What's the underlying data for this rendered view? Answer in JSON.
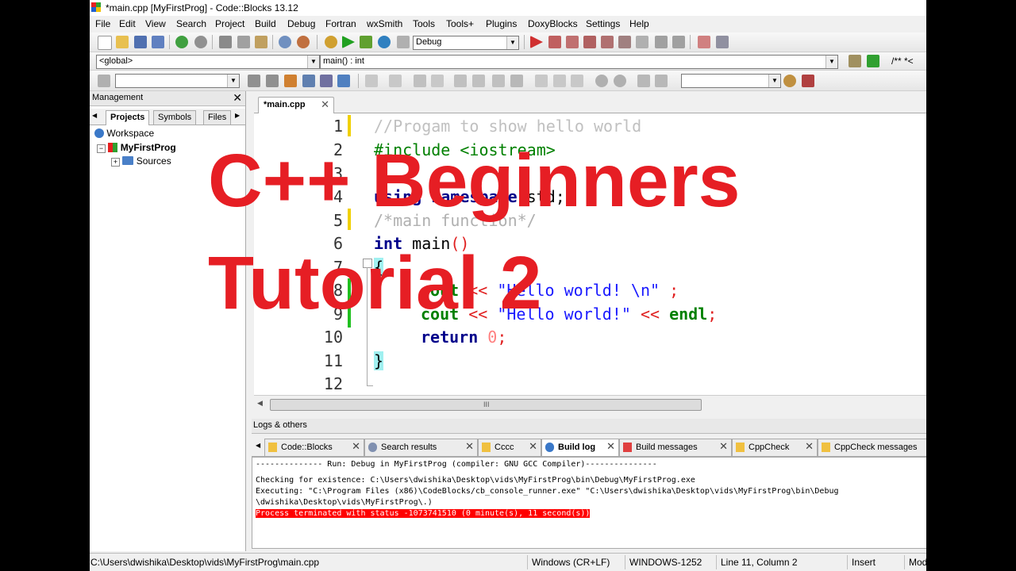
{
  "window": {
    "title": "*main.cpp [MyFirstProg] - Code::Blocks 13.12"
  },
  "menu": [
    "File",
    "Edit",
    "View",
    "Search",
    "Project",
    "Build",
    "Debug",
    "Fortran",
    "wxSmith",
    "Tools",
    "Tools+",
    "Plugins",
    "DoxyBlocks",
    "Settings",
    "Help"
  ],
  "toolbar": {
    "build_target": "Debug",
    "scope": "<global>",
    "function": "main() : int",
    "doxy_text": "/** *<"
  },
  "management": {
    "title": "Management",
    "tabs": [
      "Projects",
      "Symbols",
      "Files"
    ],
    "tree": {
      "workspace": "Workspace",
      "project": "MyFirstProg",
      "folder": "Sources"
    }
  },
  "editor": {
    "tab_label": "*main.cpp",
    "line_numbers": [
      "1",
      "2",
      "3",
      "4",
      "5",
      "6",
      "7",
      "8",
      "9",
      "10",
      "11",
      "12"
    ],
    "lines": {
      "l1": "//Progam to show hello world",
      "l2a": "#include ",
      "l2b": "<iostream>",
      "l4a": "using namespace ",
      "l4b": "std;",
      "l5": "/*main function*/",
      "l6a": "int ",
      "l6b": "main",
      "l6c": "()",
      "l7": "{",
      "l8a": "cout",
      "l8b": " << ",
      "l8c": "\"Hello world! \\n\"",
      "l8d": " ;",
      "l9a": "cout",
      "l9b": " << ",
      "l9c": "\"Hello world!\"",
      "l9d": " << ",
      "l9e": "endl",
      "l9f": ";",
      "l10a": "return ",
      "l10b": "0",
      "l10c": ";",
      "l11": "}"
    }
  },
  "logs": {
    "title": "Logs & others",
    "tabs": [
      "Code::Blocks",
      "Search results",
      "Cccc",
      "Build log",
      "Build messages",
      "CppCheck",
      "CppCheck messages"
    ],
    "active_tab": "Build log",
    "lines": [
      "-------------- Run: Debug in MyFirstProg (compiler: GNU GCC Compiler)---------------",
      "Checking for existence: C:\\Users\\dwishika\\Desktop\\vids\\MyFirstProg\\bin\\Debug\\MyFirstProg.exe",
      "Executing: \"C:\\Program Files (x86)\\CodeBlocks/cb_console_runner.exe\" \"C:\\Users\\dwishika\\Desktop\\vids\\MyFirstProg\\bin\\Debug",
      "\\dwishika\\Desktop\\vids\\MyFirstProg\\.)",
      "Process terminated with status -1073741510 (0 minute(s), 11 second(s))"
    ]
  },
  "status": {
    "path": "C:\\Users\\dwishika\\Desktop\\vids\\MyFirstProg\\main.cpp",
    "eol": "Windows (CR+LF)",
    "encoding": "WINDOWS-1252",
    "position": "Line 11, Column 2",
    "mode": "Insert",
    "extra": "Mod"
  },
  "overlay": {
    "line1": "C++ Beginners",
    "line2": "Tutorial 2"
  },
  "colors": {
    "overlay_red": "#e61e24",
    "keyword": "#00008b",
    "string": "#0000ff",
    "comment": "#c0c0c0",
    "preprocessor": "#008000",
    "number": "#ff8080"
  }
}
